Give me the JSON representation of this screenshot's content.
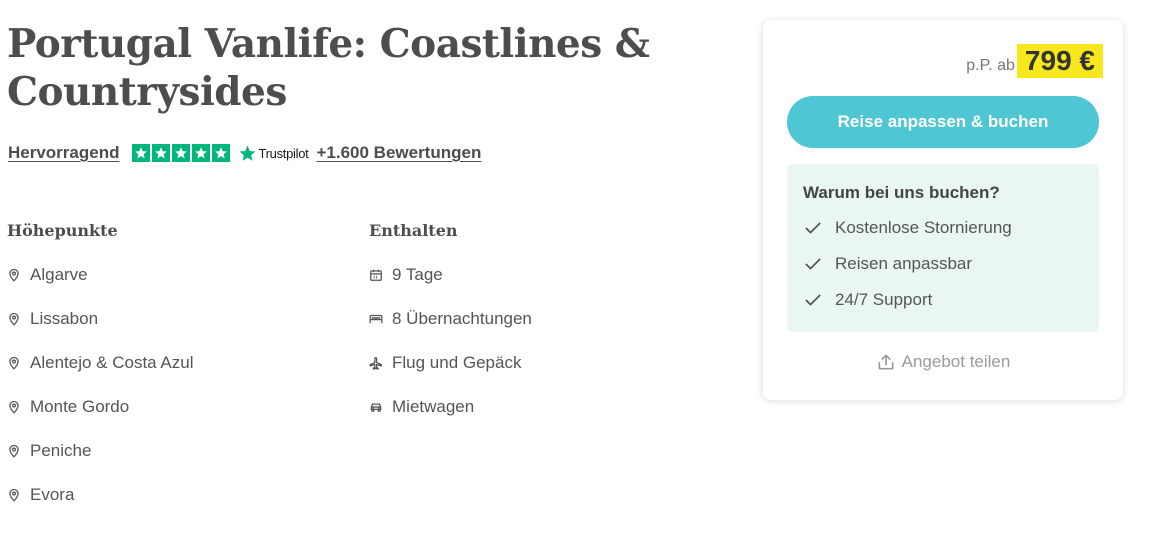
{
  "title": "Portugal Vanlife: Coastlines & Countrysides",
  "rating": {
    "word": "Hervorragend",
    "stars": 5,
    "provider": "Trustpilot",
    "reviews_link": "+1.600 Bewertungen",
    "star_color": "#00b67a"
  },
  "highlights": {
    "heading": "Höhepunkte",
    "items": [
      {
        "label": "Algarve",
        "icon": "map-pin-icon"
      },
      {
        "label": "Lissabon",
        "icon": "map-pin-icon"
      },
      {
        "label": "Alentejo & Costa Azul",
        "icon": "map-pin-icon"
      },
      {
        "label": "Monte Gordo",
        "icon": "map-pin-icon"
      },
      {
        "label": "Peniche",
        "icon": "map-pin-icon"
      },
      {
        "label": "Evora",
        "icon": "map-pin-icon"
      }
    ]
  },
  "included": {
    "heading": "Enthalten",
    "items": [
      {
        "label": "9 Tage",
        "icon": "calendar-icon"
      },
      {
        "label": "8 Übernachtungen",
        "icon": "bed-icon"
      },
      {
        "label": "Flug und Gepäck",
        "icon": "airplane-icon"
      },
      {
        "label": "Mietwagen",
        "icon": "car-icon"
      }
    ]
  },
  "booking": {
    "price_prefix": "p.P. ab",
    "price": "799 €",
    "price_highlight_color": "#f8e71c",
    "book_button": "Reise anpassen & buchen",
    "button_color": "#4ec6d3",
    "why_title": "Warum bei uns buchen?",
    "why_items": [
      "Kostenlose Stornierung",
      "Reisen anpassbar",
      "24/7 Support"
    ],
    "why_bg": "#eaf7f0",
    "share_label": "Angebot teilen"
  }
}
